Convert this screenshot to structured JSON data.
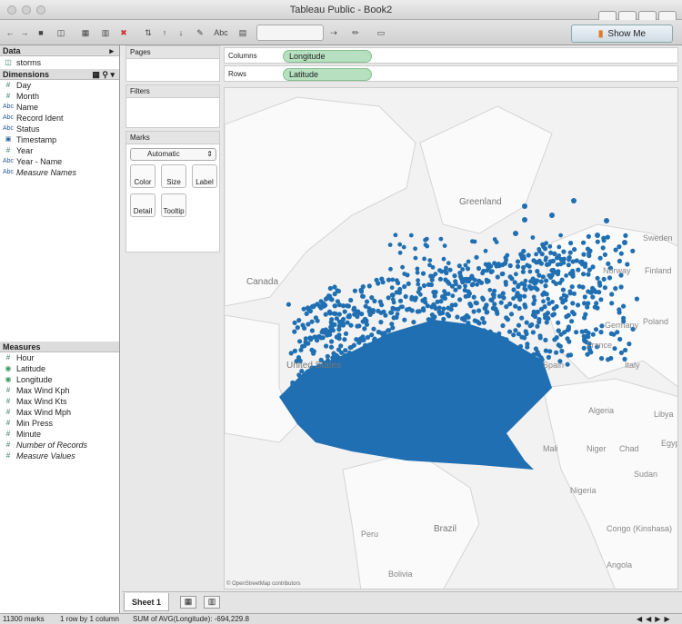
{
  "window": {
    "title": "Tableau Public - Book2"
  },
  "toolbar": {
    "showme_label": "Show Me",
    "abc_label": "Abc"
  },
  "data_pane": {
    "header": "Data",
    "source": "storms",
    "dimensions_header": "Dimensions",
    "measures_header": "Measures",
    "dimensions": [
      {
        "label": "Day",
        "icon": "number-icon",
        "italic": false
      },
      {
        "label": "Month",
        "icon": "number-icon",
        "italic": false
      },
      {
        "label": "Name",
        "icon": "abc-icon",
        "italic": false
      },
      {
        "label": "Record Ident",
        "icon": "abc-icon",
        "italic": false
      },
      {
        "label": "Status",
        "icon": "abc-icon",
        "italic": false
      },
      {
        "label": "Timestamp",
        "icon": "calendar-icon",
        "italic": false
      },
      {
        "label": "Year",
        "icon": "number-icon",
        "italic": false
      },
      {
        "label": "Year - Name",
        "icon": "abc-icon",
        "italic": false
      },
      {
        "label": "Measure Names",
        "icon": "abc-icon",
        "italic": true
      }
    ],
    "measures": [
      {
        "label": "Hour",
        "icon": "number-icon",
        "italic": false
      },
      {
        "label": "Latitude",
        "icon": "globe-icon",
        "italic": false
      },
      {
        "label": "Longitude",
        "icon": "globe-icon",
        "italic": false
      },
      {
        "label": "Max Wind Kph",
        "icon": "number-icon",
        "italic": false
      },
      {
        "label": "Max Wind Kts",
        "icon": "number-icon",
        "italic": false
      },
      {
        "label": "Max Wind Mph",
        "icon": "number-icon",
        "italic": false
      },
      {
        "label": "Min Press",
        "icon": "number-icon",
        "italic": false
      },
      {
        "label": "Minute",
        "icon": "number-icon",
        "italic": false
      },
      {
        "label": "Number of Records",
        "icon": "number-icon",
        "italic": true
      },
      {
        "label": "Measure Values",
        "icon": "number-icon",
        "italic": true
      }
    ]
  },
  "cards": {
    "pages": "Pages",
    "filters": "Filters",
    "marks": "Marks",
    "mark_type": "Automatic",
    "buttons": [
      "Color",
      "Size",
      "Label",
      "Detail",
      "Tooltip"
    ]
  },
  "shelves": {
    "columns_label": "Columns",
    "columns_pill": "Longitude",
    "rows_label": "Rows",
    "rows_pill": "Latitude"
  },
  "map": {
    "attribution": "© OpenStreetMap contributors",
    "point_color": "#1f6fb2",
    "labels": [
      "Greenland",
      "Sweden",
      "Finland",
      "Norway",
      "Canada",
      "Germany",
      "Poland",
      "France",
      "Italy",
      "United States",
      "Spain",
      "Algeria",
      "Libya",
      "Egypt",
      "Chad",
      "Niger",
      "Mali",
      "Sudan",
      "Nigeria",
      "Congo (Kinshasa)",
      "Angola",
      "Peru",
      "Brazil",
      "Bolivia"
    ]
  },
  "tabs": {
    "sheet": "Sheet 1"
  },
  "status": {
    "marks": "11300 marks",
    "rows": "1 row by 1 column",
    "sum": "SUM of AVG(Longitude): -694,229.8"
  }
}
